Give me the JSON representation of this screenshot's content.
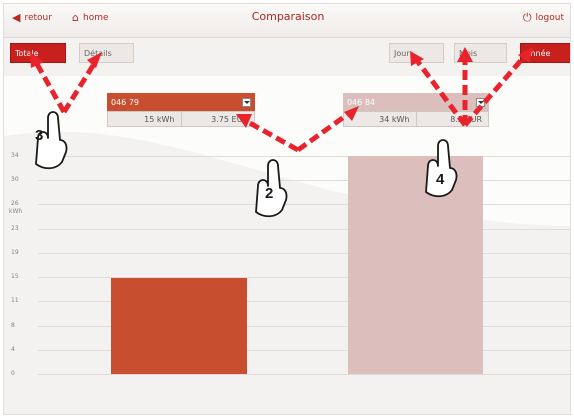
{
  "header": {
    "back_label": "retour",
    "home_label": "home",
    "title": "Comparaison",
    "logout_label": "logout"
  },
  "left_toggle": {
    "totale": "Totale",
    "details": "Détails"
  },
  "period_toggle": {
    "jour": "Jour",
    "mois": "Mois",
    "annee": "Année"
  },
  "meters": [
    {
      "id": "046 79",
      "kwh": "15 kWh",
      "eur": "3.75 EUR"
    },
    {
      "id": "046 84",
      "kwh": "34 kWh",
      "eur": "8.5 EUR"
    }
  ],
  "callouts": [
    "2",
    "3",
    "4"
  ],
  "colors": {
    "accent": "#c8201c",
    "series_a": "#c74e2e",
    "series_b": "#dcbebd"
  },
  "chart_data": {
    "type": "bar",
    "ylabel": "kWh",
    "ylim": [
      0,
      34
    ],
    "yticks": [
      "0",
      "4",
      "8",
      "11",
      "15",
      "19",
      "23",
      "26",
      "30",
      "34"
    ],
    "categories": [
      "046 79",
      "046 84"
    ],
    "values": [
      15,
      34
    ]
  }
}
